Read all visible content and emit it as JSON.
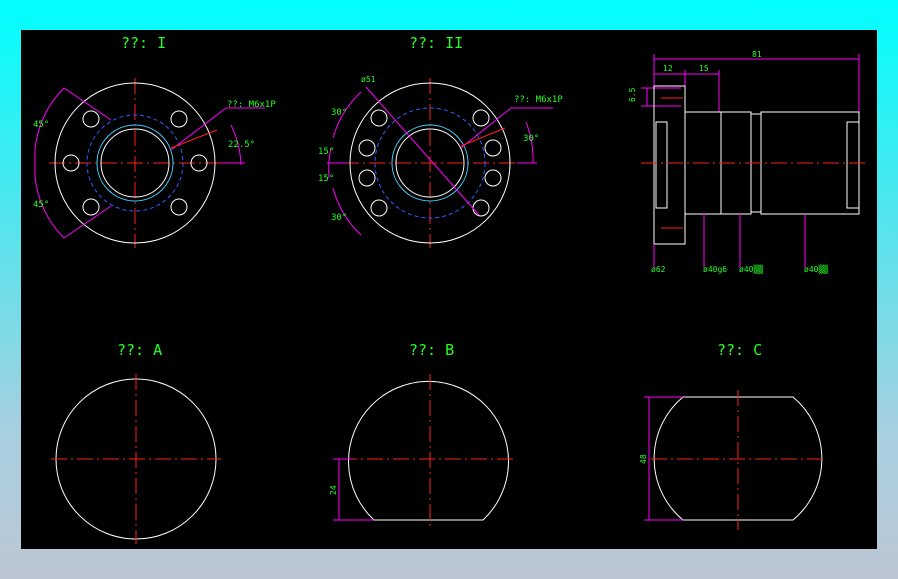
{
  "views": {
    "view1": {
      "title": "??: I",
      "callout": "??: M6x1P",
      "angle_top": "45°",
      "angle_bottom": "45°",
      "angle_right": "22.5°"
    },
    "view2": {
      "title": "??: II",
      "callout": "??: M6x1P",
      "dia": "ø51",
      "a1": "30°",
      "a2": "15°",
      "a3": "15°",
      "a4": "30°",
      "a_right": "30°"
    },
    "view3": {
      "top_overall": "81",
      "top_a": "12",
      "top_b": "15",
      "side": "6.5",
      "d1": "ø62",
      "d2": "ø40g6",
      "d3": "ø40▒▒",
      "d4": "ø40▒▒"
    },
    "viewA": {
      "title": "??: A"
    },
    "viewB": {
      "title": "??: B",
      "dim": "24"
    },
    "viewC": {
      "title": "??: C",
      "dim": "48"
    }
  },
  "colors": {
    "background": "#000000",
    "outline": "#ffffff",
    "centerline": "#ff2020",
    "dimension": "#ff00ff",
    "text": "#22ff22",
    "hidden": "#3060ff"
  }
}
